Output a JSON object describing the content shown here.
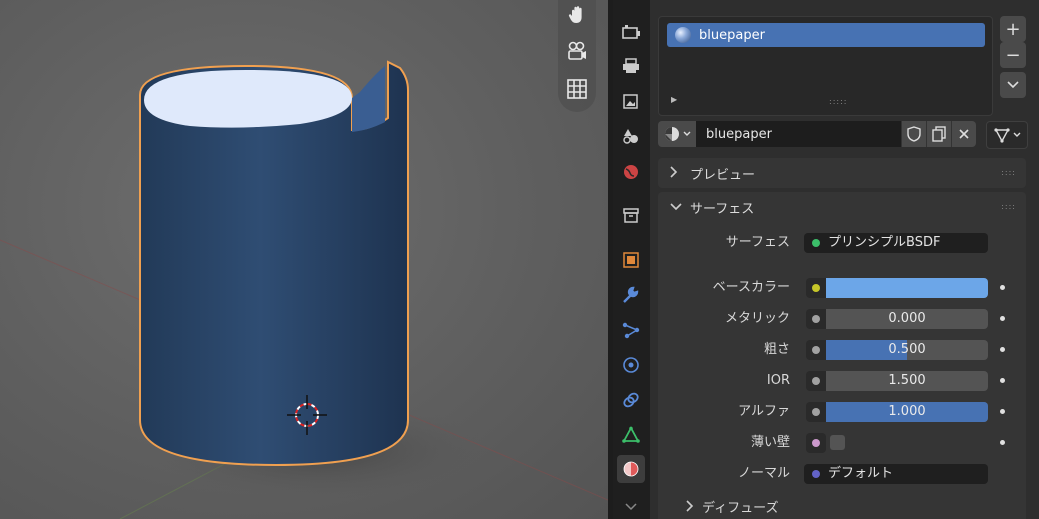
{
  "viewport": {
    "nav_icons": [
      "hand-icon",
      "camera-icon",
      "grid-icon"
    ],
    "colors": {
      "object_color": "#2e4c70",
      "outline": "#f0a050",
      "floor": "#606060"
    }
  },
  "properties_tabs": [
    "tool-icon",
    "render-icon",
    "output-icon",
    "view-layer-icon",
    "scene-icon",
    "world-icon",
    "collection-icon",
    "object-icon",
    "modifier-icon",
    "particles-icon",
    "physics-icon",
    "constraints-icon",
    "data-icon",
    "material-icon"
  ],
  "material_slots": {
    "items": [
      {
        "label": "bluepaper"
      }
    ],
    "add_label": "+",
    "remove_label": "−"
  },
  "material_selector": {
    "name": "bluepaper"
  },
  "sections": {
    "preview": "プレビュー",
    "surface": "サーフェス",
    "diffuse": "ディフューズ"
  },
  "surface": {
    "shader_label": "サーフェス",
    "shader_value": "プリンシプルBSDF",
    "props": [
      {
        "label": "ベースカラー",
        "color": "#6ca6e8",
        "socket_color": "#c7c729"
      },
      {
        "label": "メタリック",
        "value": "0.000",
        "fraction": 0.0,
        "socket_color": "#a1a1a1"
      },
      {
        "label": "粗さ",
        "value": "0.500",
        "fraction": 0.5,
        "socket_color": "#a1a1a1"
      },
      {
        "label": "IOR",
        "value": "1.500",
        "fraction": 0.0,
        "socket_color": "#a1a1a1"
      },
      {
        "label": "アルファ",
        "value": "1.000",
        "fraction": 1.0,
        "socket_color": "#a1a1a1"
      },
      {
        "label": "薄い壁",
        "checked": false,
        "socket_color": "#cc99cc"
      },
      {
        "label": "ノーマル",
        "value": "デフォルト",
        "socket_color": "#6363c7"
      }
    ]
  }
}
